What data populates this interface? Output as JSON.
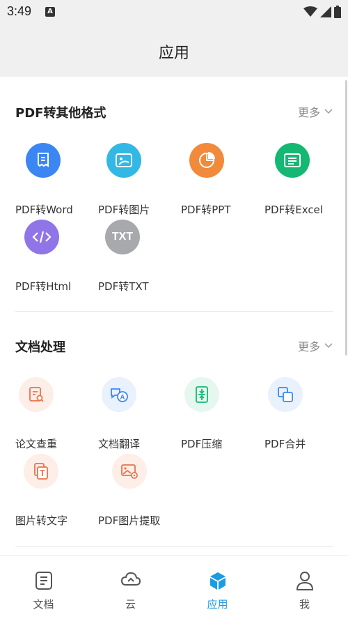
{
  "status": {
    "time": "3:49",
    "notification_glyph": "A"
  },
  "header": {
    "title": "应用"
  },
  "sections": [
    {
      "title": "PDF转其他格式",
      "more": "更多",
      "items": [
        {
          "label": "PDF转Word",
          "icon": "word-doc-icon",
          "color": "#3b86f3"
        },
        {
          "label": "PDF转图片",
          "icon": "image-icon",
          "color": "#33b7e4"
        },
        {
          "label": "PDF转PPT",
          "icon": "pie-chart-icon",
          "color": "#f28a3b"
        },
        {
          "label": "PDF转Excel",
          "icon": "table-icon",
          "color": "#14b873"
        },
        {
          "label": "PDF转Html",
          "icon": "code-icon",
          "color": "#8f75e8"
        },
        {
          "label": "PDF转TXT",
          "icon": "txt-icon",
          "icon_text": "TXT",
          "color": "#a8a9ad"
        }
      ]
    },
    {
      "title": "文档处理",
      "more": "更多",
      "items": [
        {
          "label": "论文查重",
          "icon": "document-search-icon",
          "color": "#e8734d",
          "bg": "#fdeee8"
        },
        {
          "label": "文档翻译",
          "icon": "translate-icon",
          "color": "#3b86f3",
          "bg": "#e9f1fd"
        },
        {
          "label": "PDF压缩",
          "icon": "compress-icon",
          "color": "#14b873",
          "bg": "#e6f7ef"
        },
        {
          "label": "PDF合并",
          "icon": "merge-icon",
          "color": "#3b86f3",
          "bg": "#e9f1fd"
        },
        {
          "label": "图片转文字",
          "icon": "image-to-text-icon",
          "color": "#e8734d",
          "bg": "#fdeee8"
        },
        {
          "label": "PDF图片提取",
          "icon": "image-extract-icon",
          "color": "#e8734d",
          "bg": "#fdeee8"
        }
      ]
    }
  ],
  "tabbar": {
    "tabs": [
      {
        "label": "文档",
        "icon": "document-icon",
        "active": false
      },
      {
        "label": "云",
        "icon": "cloud-icon",
        "active": false
      },
      {
        "label": "应用",
        "icon": "cube-icon",
        "active": true
      },
      {
        "label": "我",
        "icon": "person-icon",
        "active": false
      }
    ],
    "active_color": "#1a9be6",
    "inactive_color": "#555555"
  }
}
